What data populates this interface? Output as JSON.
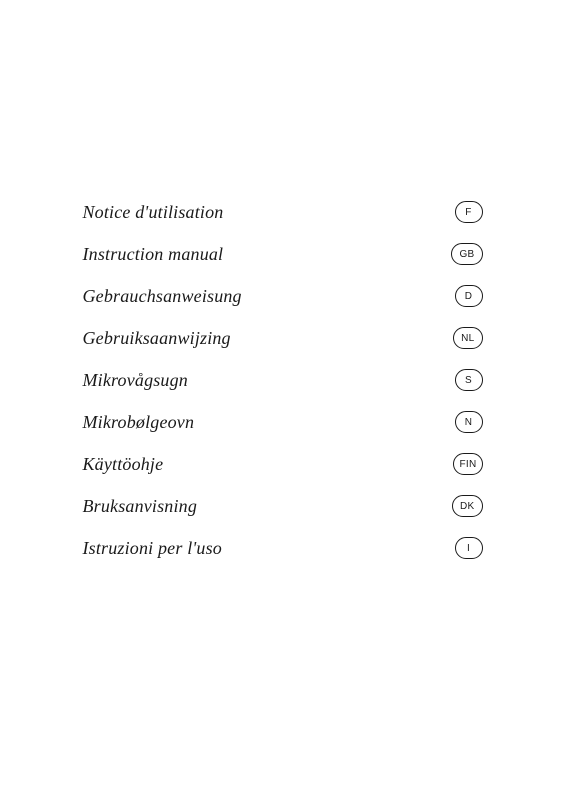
{
  "entries": [
    {
      "label": "Notice d'utilisation",
      "badge": "F"
    },
    {
      "label": "Instruction manual",
      "badge": "GB"
    },
    {
      "label": "Gebrauchsanweisung",
      "badge": "D"
    },
    {
      "label": "Gebruiksaanwijzing",
      "badge": "NL"
    },
    {
      "label": "Mikrovågsugn",
      "badge": "S"
    },
    {
      "label": "Mikrobølgeovn",
      "badge": "N"
    },
    {
      "label": "Käyttöohje",
      "badge": "FIN"
    },
    {
      "label": "Bruksanvisning",
      "badge": "DK"
    },
    {
      "label": "Istruzioni per l'uso",
      "badge": "I"
    }
  ]
}
